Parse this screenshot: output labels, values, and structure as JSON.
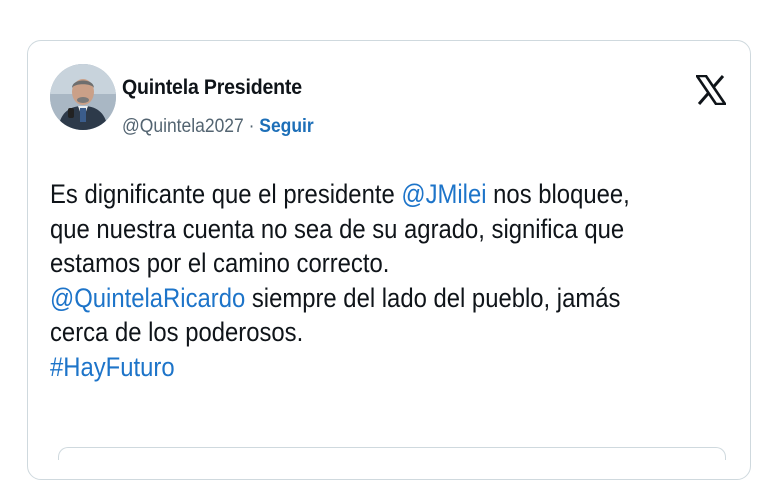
{
  "tweet": {
    "author_name": "Quintela Presidente",
    "author_handle": "@Quintela2027",
    "separator": " · ",
    "follow_label": "Seguir",
    "avatar_icon": "profile-photo",
    "platform_icon": "x-logo-icon",
    "body": {
      "line1_pre": "Es dignificante que el presidente ",
      "line1_mention": "@JMilei",
      "line1_post": " nos bloquee,",
      "line2": "que nuestra cuenta no sea de su agrado, significa que",
      "line3": "estamos por el camino correcto.",
      "line4_mention": "@QuintelaRicardo",
      "line4_post": " siempre del lado del pueblo, jamás",
      "line5": "cerca de los poderosos.",
      "line6_hashtag": "#HayFuturo"
    }
  },
  "colors": {
    "link": "#1d74c9",
    "text": "#0f1419",
    "secondary": "#536471",
    "border": "#cfd9de"
  }
}
